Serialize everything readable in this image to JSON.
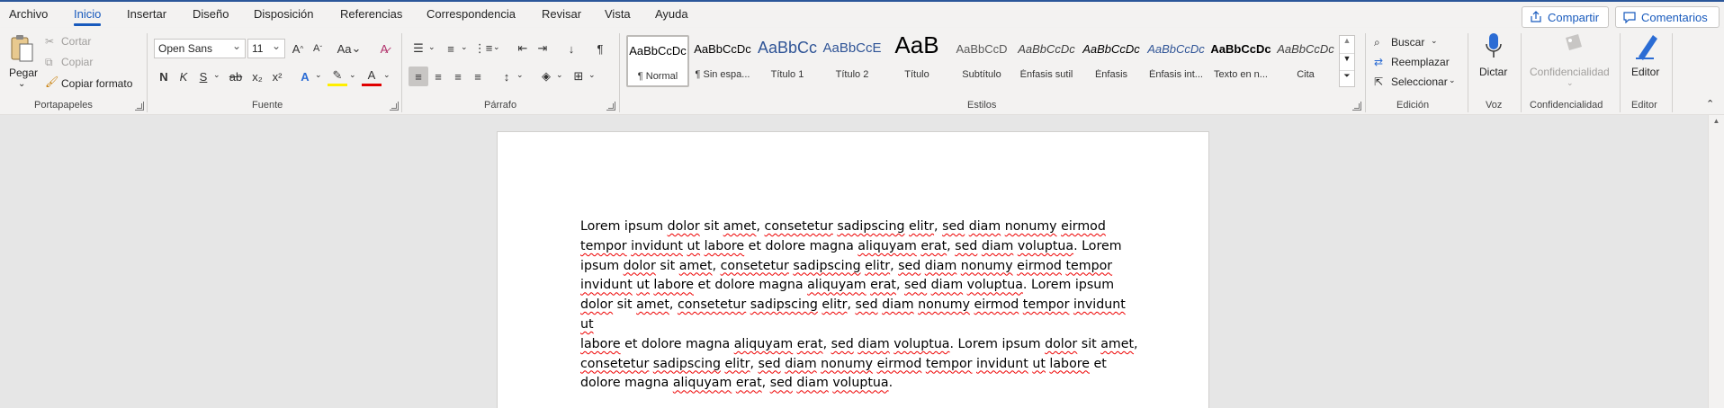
{
  "menu": {
    "tabs": [
      "Archivo",
      "Inicio",
      "Insertar",
      "Diseño",
      "Disposición",
      "Referencias",
      "Correspondencia",
      "Revisar",
      "Vista",
      "Ayuda"
    ],
    "active_tab": "Inicio",
    "share_label": "Compartir",
    "comments_label": "Comentarios"
  },
  "clipboard": {
    "paste": "Pegar",
    "cut": "Cortar",
    "copy": "Copiar",
    "format_painter": "Copiar formato",
    "group": "Portapapeles"
  },
  "font": {
    "name": "Open Sans",
    "size": "11",
    "case_label": "Aa",
    "group": "Fuente",
    "bold": "N",
    "italic": "K",
    "underline": "S",
    "strike": "ab",
    "subscript": "x₂",
    "superscript": "x²"
  },
  "paragraph": {
    "group": "Párrafo",
    "pilcrow": "¶"
  },
  "styles": {
    "group": "Estilos",
    "items": [
      {
        "preview": "AaBbCcDc",
        "name": "¶ Normal"
      },
      {
        "preview": "AaBbCcDc",
        "name": "¶ Sin espa..."
      },
      {
        "preview": "AaBbCc",
        "name": "Título 1"
      },
      {
        "preview": "AaBbCcE",
        "name": "Título 2"
      },
      {
        "preview": "AaB",
        "name": "Título"
      },
      {
        "preview": "AaBbCcD",
        "name": "Subtítulo"
      },
      {
        "preview": "AaBbCcDc",
        "name": "Énfasis sutil"
      },
      {
        "preview": "AaBbCcDc",
        "name": "Énfasis"
      },
      {
        "preview": "AaBbCcDc",
        "name": "Énfasis int..."
      },
      {
        "preview": "AaBbCcDc",
        "name": "Texto en n..."
      },
      {
        "preview": "AaBbCcDc",
        "name": "Cita"
      }
    ]
  },
  "editing": {
    "group": "Edición",
    "find": "Buscar",
    "replace": "Reemplazar",
    "select": "Seleccionar"
  },
  "voice": {
    "group": "Voz",
    "dictate": "Dictar"
  },
  "sensitivity": {
    "group": "Confidencialidad",
    "label": "Confidencialidad"
  },
  "editor": {
    "group": "Editor",
    "label": "Editor"
  },
  "document": {
    "lines": [
      "Lorem ipsum dolor sit amet, consetetur sadipscing elitr, sed diam nonumy eirmod",
      "tempor invidunt ut labore et dolore magna aliquyam erat, sed diam voluptua. Lorem",
      "ipsum dolor sit amet, consetetur sadipscing elitr, sed diam nonumy eirmod tempor",
      "invidunt ut labore et dolore magna aliquyam erat, sed diam voluptua. Lorem ipsum",
      "dolor sit amet, consetetur sadipscing elitr, sed diam nonumy eirmod tempor invidunt ut",
      "labore et dolore magna aliquyam erat, sed diam voluptua. Lorem ipsum dolor sit amet,",
      "consetetur sadipscing elitr, sed diam nonumy eirmod tempor invidunt ut labore et",
      "dolore magna aliquyam erat, sed diam voluptua."
    ]
  },
  "colors": {
    "accent": "#185abd",
    "ribbon_bg": "#f3f2f1",
    "canvas_bg": "#e6e6e6",
    "spell_underline": "#e00000"
  }
}
